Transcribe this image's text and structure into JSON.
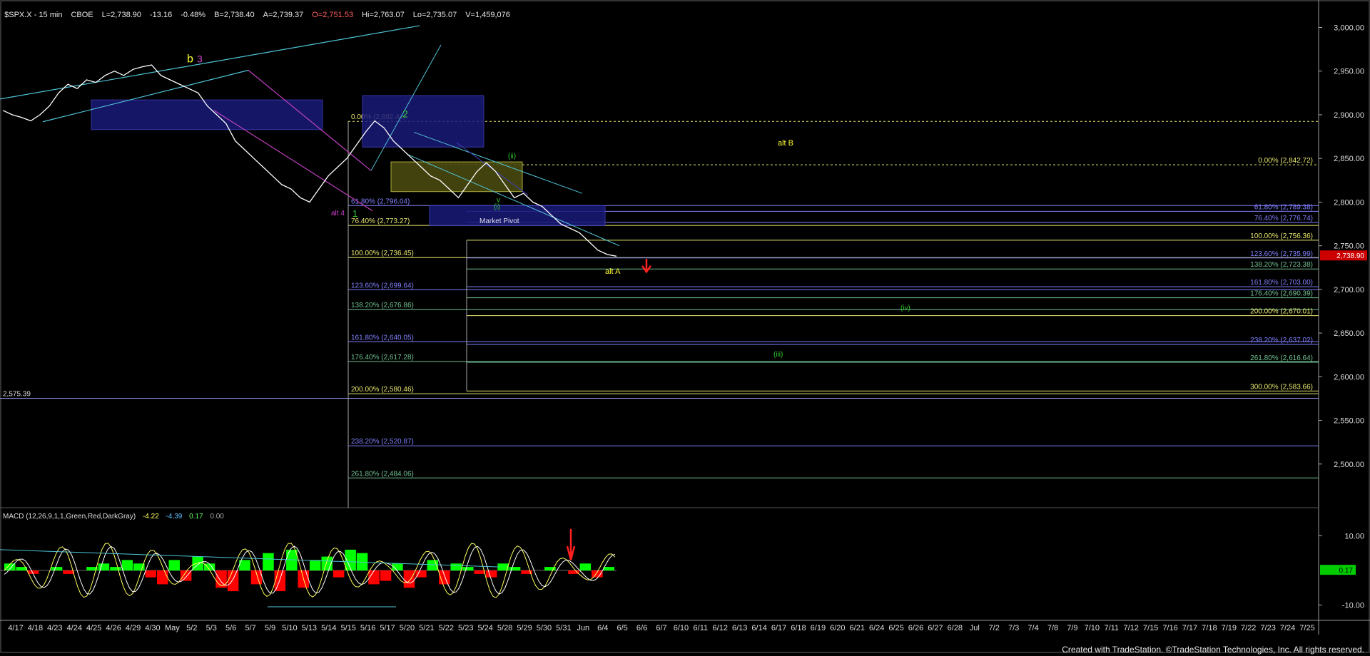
{
  "header": {
    "symbol": "$SPX.X - 15 min",
    "exchange": "CBOE",
    "last": "L=2,738.90",
    "change": "-13.16",
    "change_pct": "-0.48%",
    "bid": "B=2,738.40",
    "ask": "A=2,739.37",
    "open": "O=2,751.53",
    "high": "Hi=2,763.07",
    "low": "Lo=2,735.07",
    "volume": "V=1,459,076"
  },
  "footer": "Created with TradeStation. ©TradeStation Technologies, Inc. All rights reserved.",
  "colors": {
    "background": "#000000",
    "price": "#ffffff",
    "channel_cyan": "#4fc3d6",
    "channel_magenta": "#c040c0",
    "fib_yellow": "#e8e870",
    "fib_blue": "#8080ff",
    "fib_green": "#70c090",
    "label_green": "#33cc33",
    "label_yellow": "#ffff33",
    "label_magenta": "#d040d0",
    "arrow_red": "#ff2020",
    "macd_green": "#00ff00",
    "macd_red": "#ff0000"
  },
  "chart_data": [
    {
      "type": "line",
      "title": "$SPX.X - 15 min",
      "y_axis": {
        "min": 2450,
        "max": 3020,
        "ticks": [
          "3,000.00",
          "2,950.00",
          "2,900.00",
          "2,850.00",
          "2,800.00",
          "2,750.00",
          "2,700.00",
          "2,650.00",
          "2,600.00",
          "2,550.00",
          "2,500.00"
        ],
        "last_price_tag": "2,738.90"
      },
      "x_axis": {
        "labels": [
          "4/17",
          "4/18",
          "4/23",
          "4/24",
          "4/25",
          "4/26",
          "4/29",
          "4/30",
          "May",
          "5/2",
          "5/3",
          "5/6",
          "5/7",
          "5/9",
          "5/10",
          "5/13",
          "5/14",
          "5/15",
          "5/16",
          "5/17",
          "5/20",
          "5/21",
          "5/22",
          "5/23",
          "5/24",
          "5/28",
          "5/29",
          "5/30",
          "5/31",
          "Jun",
          "6/4",
          "6/5",
          "6/6",
          "6/7",
          "6/10",
          "6/11",
          "6/12",
          "6/13",
          "6/14",
          "6/17",
          "6/18",
          "6/19",
          "6/20",
          "6/21",
          "6/24",
          "6/25",
          "6/26",
          "6/27",
          "6/28",
          "Jul",
          "7/2",
          "7/3",
          "7/4",
          "7/8",
          "7/9",
          "7/10",
          "7/11",
          "7/12",
          "7/15",
          "7/16",
          "7/17",
          "7/18",
          "7/19",
          "7/22",
          "7/23",
          "7/24",
          "7/25"
        ]
      },
      "series": [
        {
          "values": [
            2905,
            2900,
            2897,
            2893,
            2900,
            2910,
            2925,
            2935,
            2930,
            2940,
            2937,
            2945,
            2950,
            2945,
            2952,
            2955,
            2957,
            2945,
            2940,
            2935,
            2930,
            2925,
            2910,
            2900,
            2890,
            2870,
            2860,
            2850,
            2840,
            2830,
            2820,
            2815,
            2805,
            2800,
            2815,
            2830,
            2840,
            2850,
            2865,
            2880,
            2893,
            2885,
            2870,
            2860,
            2850,
            2840,
            2830,
            2825,
            2815,
            2805,
            2820,
            2835,
            2845,
            2835,
            2820,
            2805,
            2810,
            2800,
            2795,
            2785,
            2775,
            2770,
            2765,
            2755,
            2745,
            2740,
            2738
          ]
        }
      ],
      "levels": [
        {
          "label": "0.00% (2,892.44)",
          "value": 2892.44
        },
        {
          "label": "61.80% (2,796.04)",
          "value": 2796.04
        },
        {
          "label": "76.40% (2,773.27)",
          "value": 2773.27
        },
        {
          "label": "100.00% (2,736.45)",
          "value": 2736.45
        },
        {
          "label": "123.60% (2,699.64)",
          "value": 2699.64
        },
        {
          "label": "138.20% (2,676.86)",
          "value": 2676.86
        },
        {
          "label": "161.80% (2,640.05)",
          "value": 2640.05
        },
        {
          "label": "176.40% (2,617.28)",
          "value": 2617.28
        },
        {
          "label": "200.00% (2,580.46)",
          "value": 2580.46
        },
        {
          "label": "238.20% (2,520.87)",
          "value": 2520.87
        },
        {
          "label": "261.80% (2,484.06)",
          "value": 2484.06
        },
        {
          "label": "0.00% (2,842.72)",
          "value": 2842.72
        },
        {
          "label": "61.80% (2,789.38)",
          "value": 2789.38
        },
        {
          "label": "76.40% (2,776.74)",
          "value": 2776.74
        },
        {
          "label": "100.00% (2,756.36)",
          "value": 2756.36
        },
        {
          "label": "123.60% (2,735.99)",
          "value": 2735.99
        },
        {
          "label": "138.20% (2,723.38)",
          "value": 2723.38
        },
        {
          "label": "161.80% (2,703.00)",
          "value": 2703.0
        },
        {
          "label": "176.40% (2,690.39)",
          "value": 2690.39
        },
        {
          "label": "200.00% (2,670.01)",
          "value": 2670.01
        },
        {
          "label": "238.20% (2,637.02)",
          "value": 2637.02
        },
        {
          "label": "261.80% (2,616.64)",
          "value": 2616.64
        },
        {
          "label": "300.00% (2,583.66)",
          "value": 2583.66
        },
        {
          "label": "2,575.39",
          "value": 2575.39
        }
      ],
      "annotations": [
        "b",
        "3",
        "alt 4",
        "1",
        "2",
        "(i)",
        "(ii)",
        "(iii)",
        "(iv)",
        "v",
        "alt B",
        "alt A",
        "Market Pivot"
      ]
    },
    {
      "type": "bar",
      "title": "MACD (12,26,9,1,1,Green,Red,DarkGray)",
      "values_readout": [
        "-4.22",
        "-4.39",
        "0.17",
        "0.00"
      ],
      "y_axis": {
        "min": -14,
        "max": 14,
        "ticks": [
          "10.00",
          "-10.00"
        ],
        "last_value_tag": "0.17"
      },
      "histogram": [
        2,
        1,
        -1,
        0,
        1,
        -1,
        0,
        1,
        2,
        1,
        3,
        2,
        -2,
        -4,
        3,
        -3,
        4,
        2,
        -5,
        -6,
        3,
        -4,
        5,
        -6,
        6,
        -5,
        3,
        4,
        -2,
        6,
        5,
        -4,
        -3,
        2,
        -5,
        -2,
        3,
        -4,
        2,
        1,
        -1,
        -2,
        2,
        1,
        -1,
        0,
        1,
        0,
        -1,
        2,
        -2,
        1
      ]
    }
  ]
}
